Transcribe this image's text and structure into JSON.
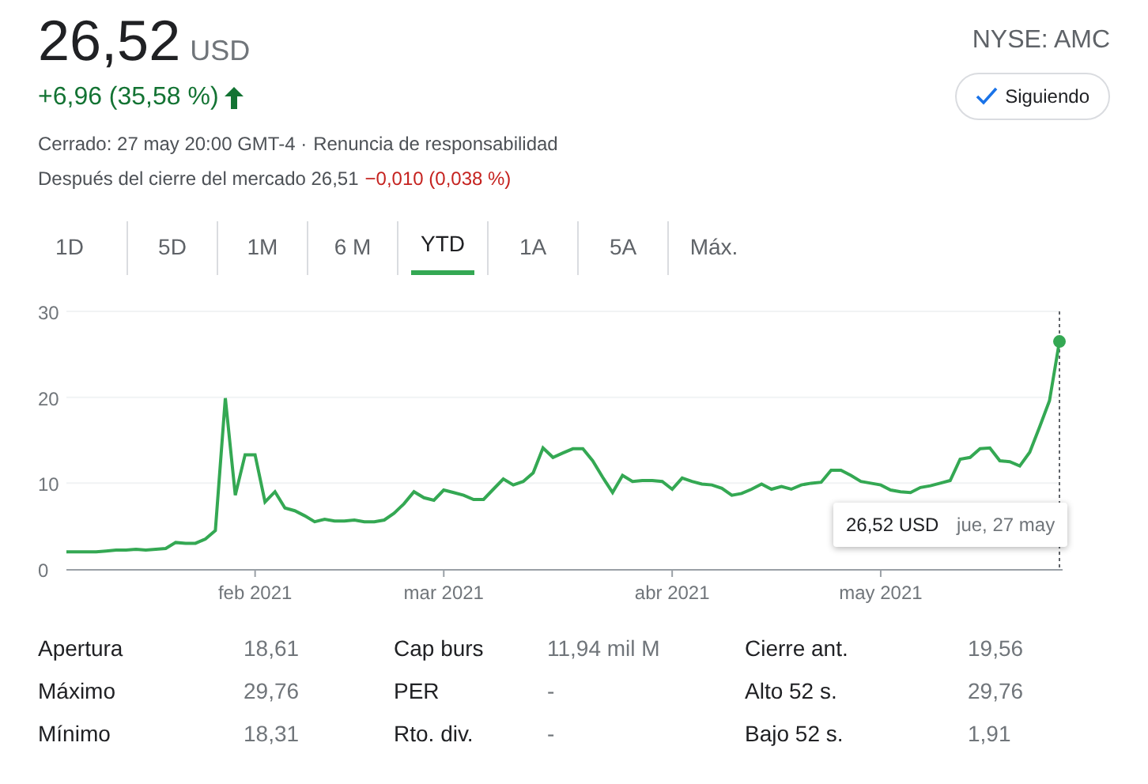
{
  "quote": {
    "price": "26,52",
    "currency": "USD",
    "change": "+6,96 (35,58 %)",
    "rising": true,
    "closed_note": "Cerrado: 27 may 20:00 GMT-4 ·",
    "disclaimer": "Renuncia de responsabilidad",
    "after_hours_label": "Después del cierre del mercado 26,51",
    "after_hours_change": "−0,010 (0,038 %)"
  },
  "exchange": "NYSE: AMC",
  "follow_button": {
    "label": "Siguiendo",
    "checked": true
  },
  "tabs": [
    {
      "label": "1D",
      "selected": false
    },
    {
      "label": "5D",
      "selected": false
    },
    {
      "label": "1M",
      "selected": false
    },
    {
      "label": "6 M",
      "selected": false
    },
    {
      "label": "YTD",
      "selected": true
    },
    {
      "label": "1A",
      "selected": false
    },
    {
      "label": "5A",
      "selected": false
    },
    {
      "label": "Máx.",
      "selected": false
    }
  ],
  "chart": {
    "tooltip": {
      "value": "26,52 USD",
      "date": "jue, 27 may"
    },
    "chart_data": {
      "type": "line",
      "categories": [
        null,
        null,
        null,
        null,
        null,
        null,
        null,
        null,
        null,
        null,
        null,
        null,
        null,
        null,
        null,
        null,
        null,
        null,
        null,
        "feb 2021",
        null,
        null,
        null,
        null,
        null,
        null,
        null,
        null,
        null,
        null,
        null,
        null,
        null,
        null,
        null,
        null,
        null,
        null,
        "mar 2021",
        null,
        null,
        null,
        null,
        null,
        null,
        null,
        null,
        null,
        null,
        null,
        null,
        null,
        null,
        null,
        null,
        null,
        null,
        null,
        null,
        null,
        null,
        "abr 2021",
        null,
        null,
        null,
        null,
        null,
        null,
        null,
        null,
        null,
        null,
        null,
        null,
        null,
        null,
        null,
        null,
        null,
        null,
        null,
        null,
        "may 2021",
        null,
        null,
        null,
        null,
        null,
        null,
        null,
        null,
        null,
        null,
        null,
        null,
        null,
        null,
        null,
        null,
        null,
        null
      ],
      "series": [
        {
          "color": "#34a853",
          "values": [
            2.0,
            2.0,
            2.0,
            2.0,
            2.1,
            2.2,
            2.2,
            2.3,
            2.2,
            2.3,
            2.4,
            3.1,
            3.0,
            3.0,
            3.5,
            4.5,
            19.9,
            8.6,
            13.3,
            13.3,
            7.8,
            9.0,
            7.1,
            6.8,
            6.2,
            5.5,
            5.8,
            5.6,
            5.6,
            5.7,
            5.5,
            5.5,
            5.7,
            6.5,
            7.6,
            9.0,
            8.3,
            8.0,
            9.2,
            8.9,
            8.6,
            8.1,
            8.1,
            9.3,
            10.5,
            9.8,
            10.2,
            11.2,
            14.1,
            13.0,
            13.5,
            14.0,
            14.0,
            12.6,
            10.7,
            8.9,
            10.9,
            10.2,
            10.3,
            10.3,
            10.2,
            9.3,
            10.6,
            10.2,
            9.9,
            9.8,
            9.4,
            8.6,
            8.8,
            9.3,
            9.9,
            9.3,
            9.6,
            9.3,
            9.8,
            10.0,
            10.1,
            11.5,
            11.5,
            10.9,
            10.2,
            10.0,
            9.8,
            9.2,
            9.0,
            8.9,
            9.5,
            9.7,
            10.0,
            10.3,
            12.8,
            13.0,
            14.0,
            14.1,
            12.6,
            12.5,
            12.0,
            13.6,
            16.5,
            19.6,
            26.5
          ]
        }
      ],
      "ylim": [
        0,
        30
      ],
      "yticks": [
        0,
        10,
        20,
        30
      ]
    }
  },
  "stats": [
    [
      {
        "label": "Apertura",
        "value": "18,61"
      },
      {
        "label": "Máximo",
        "value": "29,76"
      },
      {
        "label": "Mínimo",
        "value": "18,31"
      }
    ],
    [
      {
        "label": "Cap burs",
        "value": "11,94 mil M"
      },
      {
        "label": "PER",
        "value": "-"
      },
      {
        "label": "Rto. div.",
        "value": "-"
      }
    ],
    [
      {
        "label": "Cierre ant.",
        "value": "19,56"
      },
      {
        "label": "Alto 52 s.",
        "value": "29,76"
      },
      {
        "label": "Bajo 52 s.",
        "value": "1,91"
      }
    ]
  ]
}
